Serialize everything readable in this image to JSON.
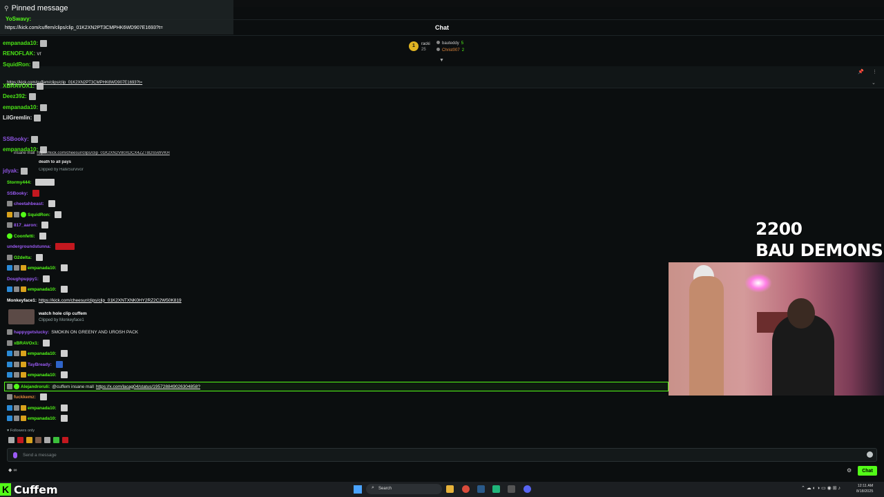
{
  "pinned": {
    "title": "Pinned message",
    "user": "YoSwavy:",
    "url": "https://kick.com/cuffem/clips/clip_01K2XN2PT3CMPHK6WD907E1693?t="
  },
  "header": {
    "title": "Chat"
  },
  "leaderboard": {
    "top_user": "racki",
    "top_count": "25",
    "rows": [
      {
        "user": "bauteddy",
        "count": "5"
      },
      {
        "user": "Christ007",
        "count": "2"
      }
    ]
  },
  "pin_bar": {
    "url": "https://kick.com/cuffem/clips/clip_01K2XN2PT3CMPHK6WD907E1693?t="
  },
  "ghost_lines": [
    {
      "user": "empanada10:",
      "color": "#53fc18"
    },
    {
      "user": "RENOFLAK:",
      "text": "vr",
      "color": "#53fc18"
    },
    {
      "user": "SquidRon:",
      "color": "#53fc18"
    },
    {
      "user": "XBRAVOX1:",
      "color": "#53fc18"
    },
    {
      "user": "Deez392:",
      "color": "#53fc18"
    },
    {
      "user": "empanada10:",
      "color": "#53fc18"
    },
    {
      "user": "LilGremlin:",
      "color": "#ffffff"
    },
    {
      "user": "SSBooky:",
      "color": "#9b5bf5"
    },
    {
      "user": "empanada10:",
      "color": "#53fc18"
    },
    {
      "user": "jdyak:",
      "color": "#9b5bf5"
    }
  ],
  "ghost_clip": {
    "link_text": "insane mall",
    "url": "https://kick.com/cheesur/clips/clip_01K2XN2V80XDCX4ZZT8DS5WVKH",
    "title": "death to all pays",
    "by": "Clipped by HateSurvivor"
  },
  "messages": [
    {
      "user": "Stormy444:",
      "color": "#53fc18"
    },
    {
      "user": "SSBooky:",
      "color": "#9b5bf5"
    },
    {
      "user": "cheetahbeast:",
      "color": "#9b5bf5"
    },
    {
      "user": "SquidRon:",
      "color": "#53fc18"
    },
    {
      "user": "817_aaron:",
      "color": "#9b5bf5"
    },
    {
      "user": "Coonfetti:",
      "color": "#53fc18"
    },
    {
      "user": "undergroundstunna:",
      "color": "#9b5bf5"
    },
    {
      "user": "O2delta:",
      "color": "#53fc18"
    },
    {
      "user": "empanada10:",
      "color": "#53fc18"
    },
    {
      "user": "Doughpuppy1:",
      "color": "#9b5bf5"
    },
    {
      "user": "empanada10:",
      "color": "#53fc18"
    },
    {
      "user": "Monkeyface1:",
      "color": "#ffffff",
      "link": "https://kick.com/cheesur/clips/clip_01K2XNTXNK0HY2RZ2C2W50K819"
    },
    {
      "user": "happygetslucky:",
      "color": "#9b5bf5",
      "text": "SMOKIN ON GREENY AND UROSH PACK"
    },
    {
      "user": "xBRAVOx1:",
      "color": "#53fc18"
    },
    {
      "user": "empanada10:",
      "color": "#53fc18"
    },
    {
      "user": "TayBready:",
      "color": "#9b5bf5"
    },
    {
      "user": "empanada10:",
      "color": "#53fc18"
    },
    {
      "user": "Alejandroruli:",
      "color": "#53fc18",
      "text": "@cuffem insane mall",
      "link": "https://x.com/lacag04/status/195728849026304858?"
    },
    {
      "user": "fuckkemz:",
      "color": "#e68a3c"
    },
    {
      "user": "empanada10:",
      "color": "#53fc18"
    },
    {
      "user": "empanada10:",
      "color": "#53fc18"
    }
  ],
  "clip_card": {
    "title": "watch hole clip cuffem",
    "by": "Clipped by Monkeyface1"
  },
  "followers_only": "Followers only",
  "input": {
    "placeholder": "Send a message"
  },
  "chat_button": "Chat",
  "overlay": {
    "line1": "2200",
    "line2": "BAU DEMONS"
  },
  "brand": {
    "name": "Cuffem"
  },
  "taskbar": {
    "search": "Search"
  },
  "clock": {
    "time": "12:11 AM",
    "date": "8/18/2025"
  }
}
